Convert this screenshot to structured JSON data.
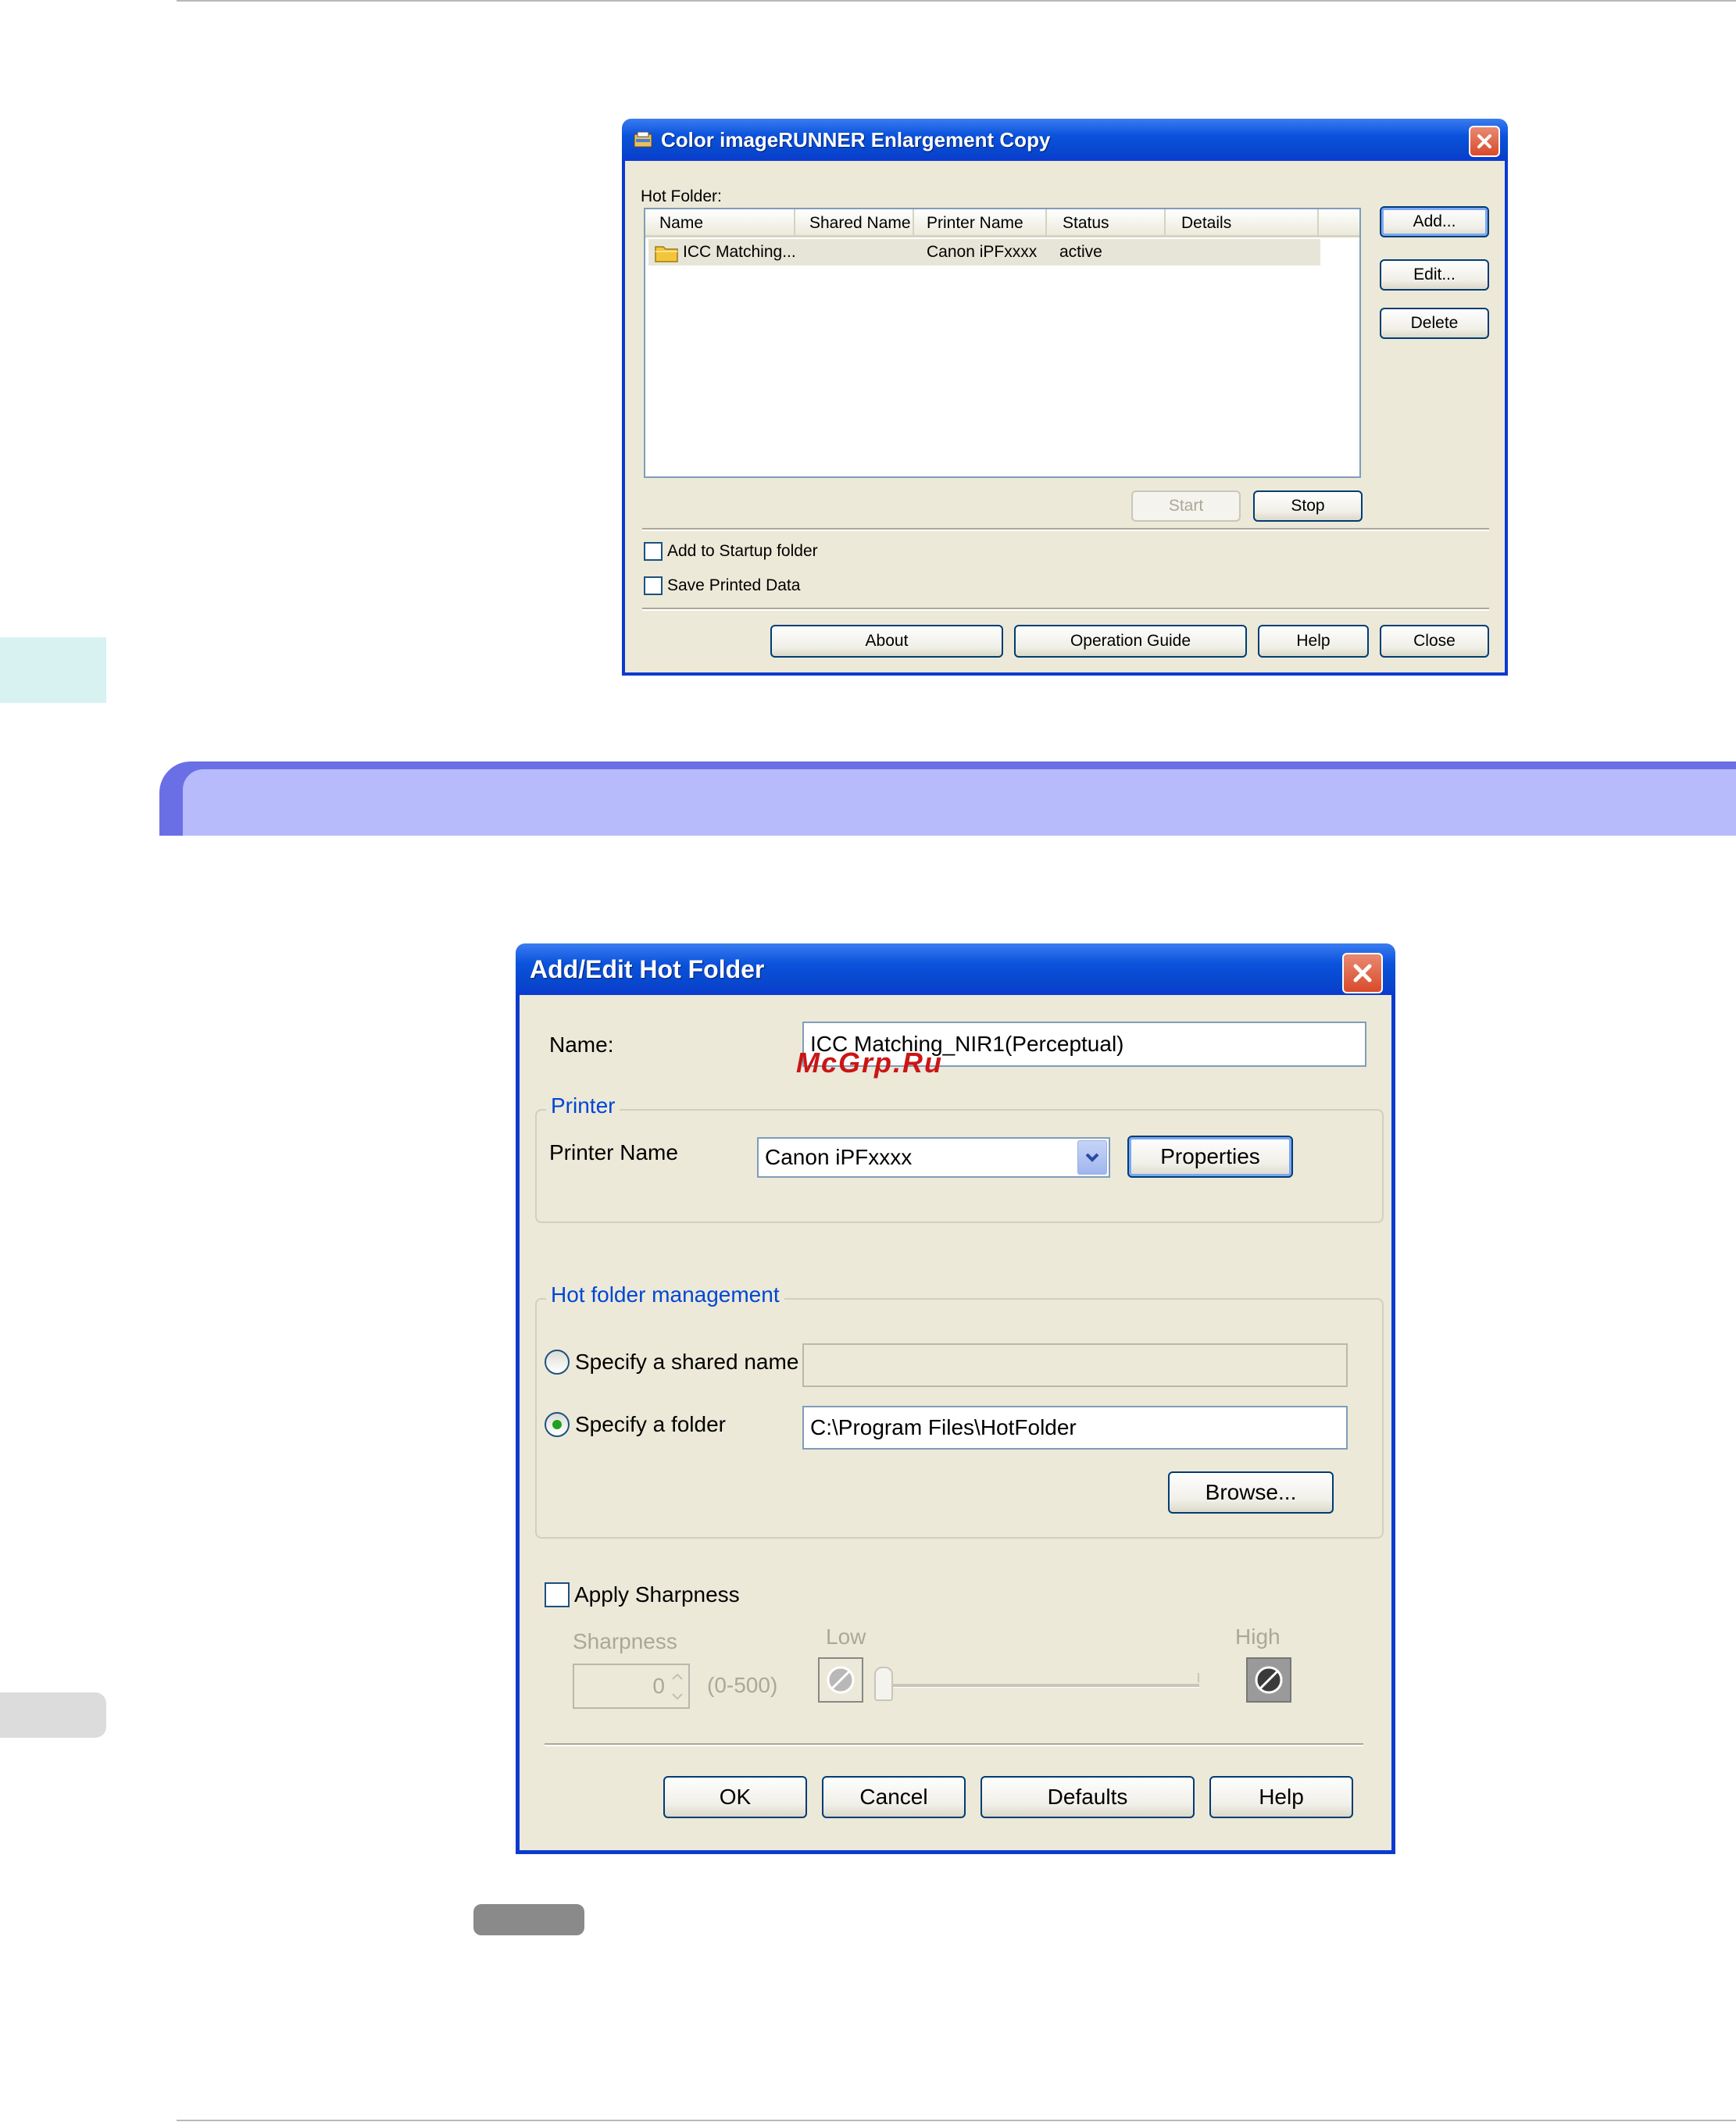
{
  "window1": {
    "title": "Color imageRUNNER Enlargement Copy",
    "hot_folder_label": "Hot Folder:",
    "columns": [
      "Name",
      "Shared Name",
      "Printer Name",
      "Status",
      "Details"
    ],
    "rows": [
      {
        "name": "ICC Matching...",
        "shared_name": "",
        "printer_name": "Canon iPFxxxx",
        "status": "active",
        "details": ""
      }
    ],
    "buttons": {
      "add": "Add...",
      "edit": "Edit...",
      "delete": "Delete",
      "start": "Start",
      "stop": "Stop",
      "about": "About",
      "operation_guide": "Operation Guide",
      "help": "Help",
      "close": "Close"
    },
    "checkboxes": {
      "startup": "Add to Startup folder",
      "save_printed": "Save Printed Data"
    }
  },
  "window2": {
    "title": "Add/Edit Hot Folder",
    "name_label": "Name:",
    "name_value": "ICC Matching_NIR1(Perceptual)",
    "watermark": "McGrp.Ru",
    "printer_group": "Printer",
    "printer_name_label": "Printer Name",
    "printer_value": "Canon iPFxxxx",
    "properties_button": "Properties",
    "hot_folder_group": "Hot folder management",
    "radio_shared": "Specify a shared name",
    "radio_folder": "Specify a folder",
    "shared_value": "",
    "folder_value": "C:\\Program Files\\HotFolder",
    "browse_button": "Browse...",
    "apply_sharpness": "Apply Sharpness",
    "sharpness_label": "Sharpness",
    "sharpness_value": "0",
    "sharpness_range": "(0-500)",
    "low_label": "Low",
    "high_label": "High",
    "buttons": {
      "ok": "OK",
      "cancel": "Cancel",
      "defaults": "Defaults",
      "help": "Help"
    }
  }
}
